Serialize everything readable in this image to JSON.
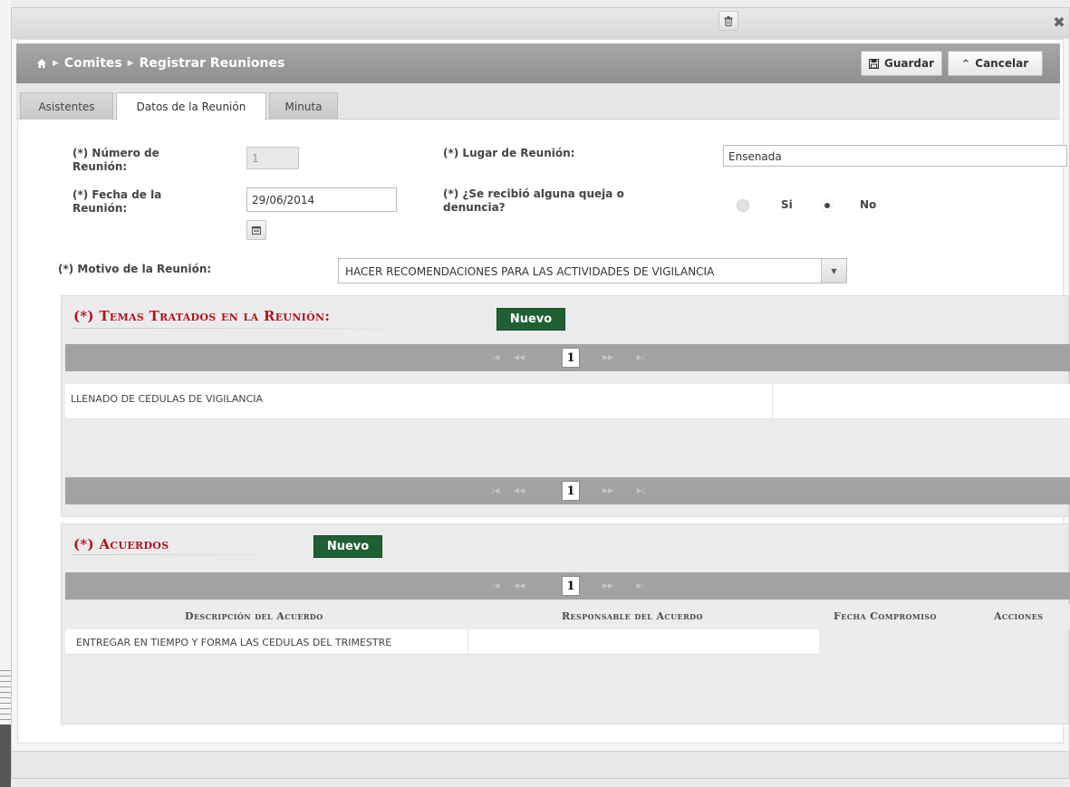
{
  "breadcrumb": {
    "items": [
      "Comites",
      "Registrar Reuniones"
    ]
  },
  "toolbar": {
    "save_label": "Guardar",
    "cancel_label": "Cancelar"
  },
  "tabs": [
    {
      "label": "Asistentes",
      "active": false
    },
    {
      "label": "Datos de la Reunión",
      "active": true
    },
    {
      "label": "Minuta",
      "active": false
    }
  ],
  "form": {
    "numero_label": "(*) Número de Reunión:",
    "numero_value": "1",
    "fecha_label": "(*) Fecha de la Reunión:",
    "fecha_value": "29/06/2014",
    "lugar_label": "(*) Lugar de Reunión:",
    "lugar_value": "Ensenada",
    "queja_label": "(*) ¿Se recibió alguna queja o denuncia?",
    "queja_options": [
      "Si",
      "No"
    ],
    "queja_selected": "No",
    "motivo_label": "(*) Motivo de la Reunión:",
    "motivo_value": "HACER RECOMENDACIONES PARA LAS ACTIVIDADES DE VIGILANCIA"
  },
  "temas": {
    "title": "(*) Temas Tratados en la Reunión:",
    "new_label": "Nuevo",
    "page": "1",
    "rows": [
      "LLENADO DE CEDULAS DE VIGILANCIA"
    ]
  },
  "acuerdos": {
    "title": "(*) Acuerdos",
    "new_label": "Nuevo",
    "page": "1",
    "columns": [
      "Descripción del Acuerdo",
      "Responsable del Acuerdo",
      "Fecha Compromiso",
      "Acciones"
    ],
    "rows": [
      {
        "descripcion": "ENTREGAR EN TIEMPO Y FORMA LAS CEDULAS DEL TRIMESTRE",
        "responsable": ""
      }
    ]
  },
  "colors": {
    "accent_red": "#b5121b",
    "nuevo_green": "#1f5f34",
    "header_gray": "#999999"
  }
}
